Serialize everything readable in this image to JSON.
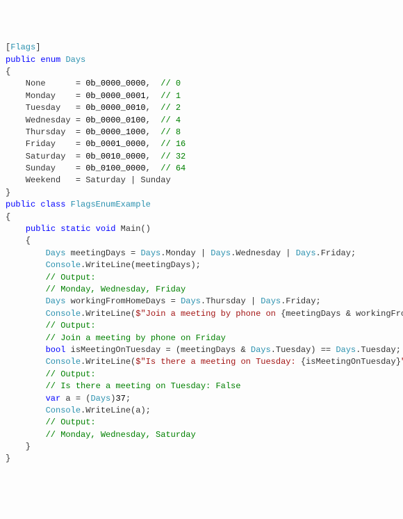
{
  "code": {
    "l01a": "[",
    "l01b": "Flags",
    "l01c": "]",
    "l02a": "public",
    "l02b": " ",
    "l02c": "enum",
    "l02d": " ",
    "l02e": "Days",
    "l03": "{",
    "l04a": "    None      = ",
    "l04b": "0b_0000_0000",
    "l04c": ",  ",
    "l04d": "// 0",
    "l05a": "    Monday    = ",
    "l05b": "0b_0000_0001",
    "l05c": ",  ",
    "l05d": "// 1",
    "l06a": "    Tuesday   = ",
    "l06b": "0b_0000_0010",
    "l06c": ",  ",
    "l06d": "// 2",
    "l07a": "    Wednesday = ",
    "l07b": "0b_0000_0100",
    "l07c": ",  ",
    "l07d": "// 4",
    "l08a": "    Thursday  = ",
    "l08b": "0b_0000_1000",
    "l08c": ",  ",
    "l08d": "// 8",
    "l09a": "    Friday    = ",
    "l09b": "0b_0001_0000",
    "l09c": ",  ",
    "l09d": "// 16",
    "l10a": "    Saturday  = ",
    "l10b": "0b_0010_0000",
    "l10c": ",  ",
    "l10d": "// 32",
    "l11a": "    Sunday    = ",
    "l11b": "0b_0100_0000",
    "l11c": ",  ",
    "l11d": "// 64",
    "l12": "    Weekend   = Saturday | Sunday",
    "l13": "}",
    "l14": "",
    "l15a": "public",
    "l15b": " ",
    "l15c": "class",
    "l15d": " ",
    "l15e": "FlagsEnumExample",
    "l16": "{",
    "l17a": "    ",
    "l17b": "public",
    "l17c": " ",
    "l17d": "static",
    "l17e": " ",
    "l17f": "void",
    "l17g": " Main()",
    "l18": "    {",
    "l19a": "        ",
    "l19b": "Days",
    "l19c": " meetingDays = ",
    "l19d": "Days",
    "l19e": ".Monday | ",
    "l19f": "Days",
    "l19g": ".Wednesday | ",
    "l19h": "Days",
    "l19i": ".Friday;",
    "l20a": "        ",
    "l20b": "Console",
    "l20c": ".WriteLine(meetingDays);",
    "l21a": "        ",
    "l21b": "// Output:",
    "l22a": "        ",
    "l22b": "// Monday, Wednesday, Friday",
    "l23": "",
    "l24a": "        ",
    "l24b": "Days",
    "l24c": " workingFromHomeDays = ",
    "l24d": "Days",
    "l24e": ".Thursday | ",
    "l24f": "Days",
    "l24g": ".Friday;",
    "l25a": "        ",
    "l25b": "Console",
    "l25c": ".WriteLine(",
    "l25d": "$\"Join a meeting by phone on ",
    "l25e": "{meetingDays & workingFromHomeDays}",
    "l25f": "\"",
    "l25g": ");",
    "l26a": "        ",
    "l26b": "// Output:",
    "l27a": "        ",
    "l27b": "// Join a meeting by phone on Friday",
    "l28": "",
    "l29a": "        ",
    "l29b": "bool",
    "l29c": " isMeetingOnTuesday = (meetingDays & ",
    "l29d": "Days",
    "l29e": ".Tuesday) == ",
    "l29f": "Days",
    "l29g": ".Tuesday;",
    "l30a": "        ",
    "l30b": "Console",
    "l30c": ".WriteLine(",
    "l30d": "$\"Is there a meeting on Tuesday: ",
    "l30e": "{isMeetingOnTuesday}",
    "l30f": "\"",
    "l30g": ");",
    "l31a": "        ",
    "l31b": "// Output:",
    "l32a": "        ",
    "l32b": "// Is there a meeting on Tuesday: False",
    "l33": "",
    "l34a": "        ",
    "l34b": "var",
    "l34c": " a = (",
    "l34d": "Days",
    "l34e": ")",
    "l34f": "37",
    "l34g": ";",
    "l35a": "        ",
    "l35b": "Console",
    "l35c": ".WriteLine(a);",
    "l36a": "        ",
    "l36b": "// Output:",
    "l37a": "        ",
    "l37b": "// Monday, Wednesday, Saturday",
    "l38": "    }",
    "l39": "}"
  }
}
